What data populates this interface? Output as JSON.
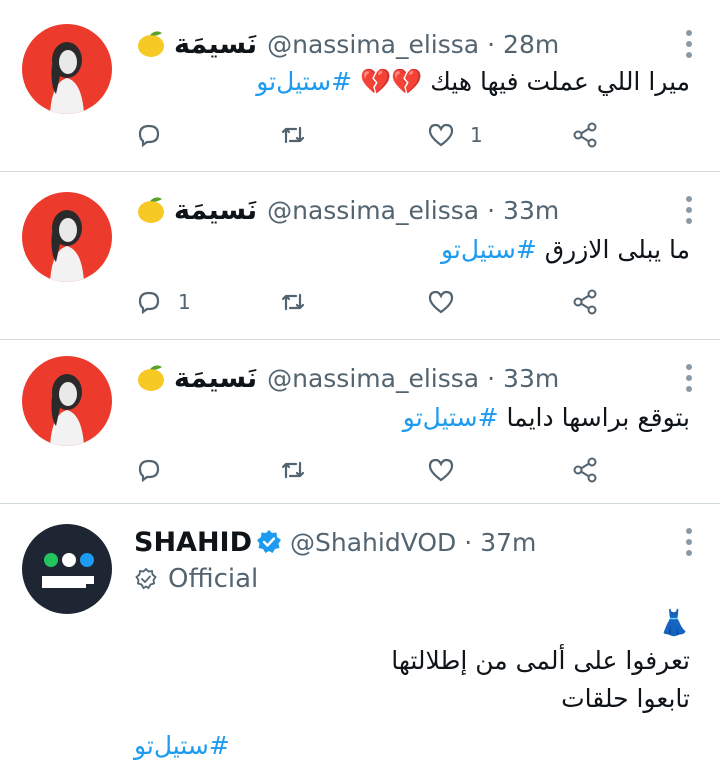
{
  "tweets": [
    {
      "display_name": "نَسيمَة",
      "handle": "@nassima_elissa",
      "time": "28m",
      "text": "ميرا اللي عملت فيها هيك",
      "emoji": "💔💔",
      "hashtag": "#ستيل‌تو",
      "actions": {
        "replies": "",
        "retweets": "",
        "likes": "1"
      }
    },
    {
      "display_name": "نَسيمَة",
      "handle": "@nassima_elissa",
      "time": "33m",
      "text": "ما يبلى الازرق",
      "hashtag": "#ستيل‌تو",
      "actions": {
        "replies": "1",
        "retweets": "",
        "likes": ""
      }
    },
    {
      "display_name": "نَسيمَة",
      "handle": "@nassima_elissa",
      "time": "33m",
      "text": "بتوقع براسها دايما",
      "hashtag": "#ستيل‌تو",
      "actions": {
        "replies": "",
        "retweets": "",
        "likes": ""
      }
    },
    {
      "display_name": "SHAHID",
      "handle": "@ShahidVOD",
      "time": "37m",
      "label": "Official",
      "emoji": "👗",
      "line1": "تعرفوا على ألمى من إطلالتها",
      "line2": "تابعوا حلقات",
      "hashtag": "#ستيل‌تو"
    }
  ],
  "separator": "·",
  "colors": {
    "link": "#1d9bf0",
    "verified": "#1d9bf0",
    "avatar_red": "#ec3b2c",
    "shahid_dots": [
      "#22c55e",
      "#ffffff",
      "#1d9bf0"
    ]
  },
  "icons": [
    "lemon-icon",
    "more-icon",
    "reply-icon",
    "retweet-icon",
    "like-icon",
    "share-icon",
    "verified-badge-icon",
    "official-badge-icon"
  ]
}
